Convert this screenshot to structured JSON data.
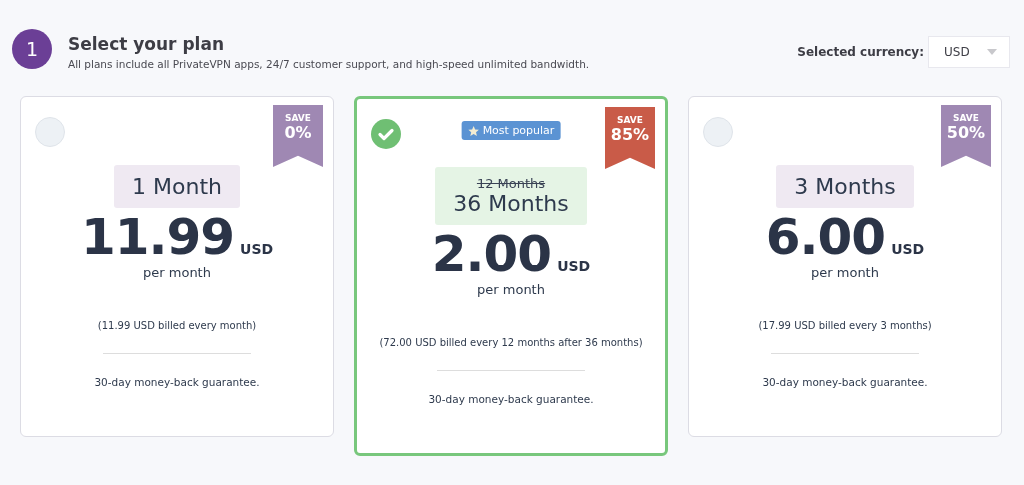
{
  "step": {
    "number": "1",
    "title": "Select your plan",
    "subtitle": "All plans include all PrivateVPN apps, 24/7 customer support, and high-speed unlimited bandwidth."
  },
  "currency": {
    "label": "Selected currency:",
    "value": "USD"
  },
  "plans": [
    {
      "selected": false,
      "save_label": "SAVE",
      "save": "0%",
      "period": "1 Month",
      "price": "11.99",
      "unit": "USD",
      "per": "per month",
      "billed": "(11.99 USD billed every month)",
      "guarantee": "30-day money-back guarantee."
    },
    {
      "selected": true,
      "badge": "Most popular",
      "save_label": "SAVE",
      "save": "85%",
      "old_period": "12 Months",
      "period": "36 Months",
      "price": "2.00",
      "unit": "USD",
      "per": "per month",
      "billed": "(72.00 USD billed every 12 months after 36 months)",
      "guarantee": "30-day money-back guarantee."
    },
    {
      "selected": false,
      "save_label": "SAVE",
      "save": "50%",
      "period": "3 Months",
      "price": "6.00",
      "unit": "USD",
      "per": "per month",
      "billed": "(17.99 USD billed every 3 months)",
      "guarantee": "30-day money-back guarantee."
    }
  ]
}
